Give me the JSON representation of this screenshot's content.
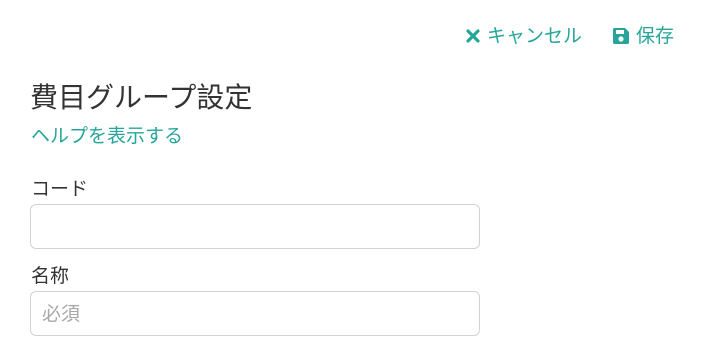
{
  "toolbar": {
    "cancel_label": "キャンセル",
    "cancel_icon": "close-icon",
    "save_label": "保存",
    "save_icon": "floppy-disk-icon"
  },
  "page": {
    "title": "費目グループ設定",
    "help_link": "ヘルプを表示する"
  },
  "form": {
    "code": {
      "label": "コード",
      "value": "",
      "placeholder": ""
    },
    "name": {
      "label": "名称",
      "value": "",
      "placeholder": "必須"
    }
  },
  "colors": {
    "accent": "#26a69a",
    "text": "#333333",
    "input_border": "#d2d2d2",
    "placeholder": "#a8a8a8"
  }
}
